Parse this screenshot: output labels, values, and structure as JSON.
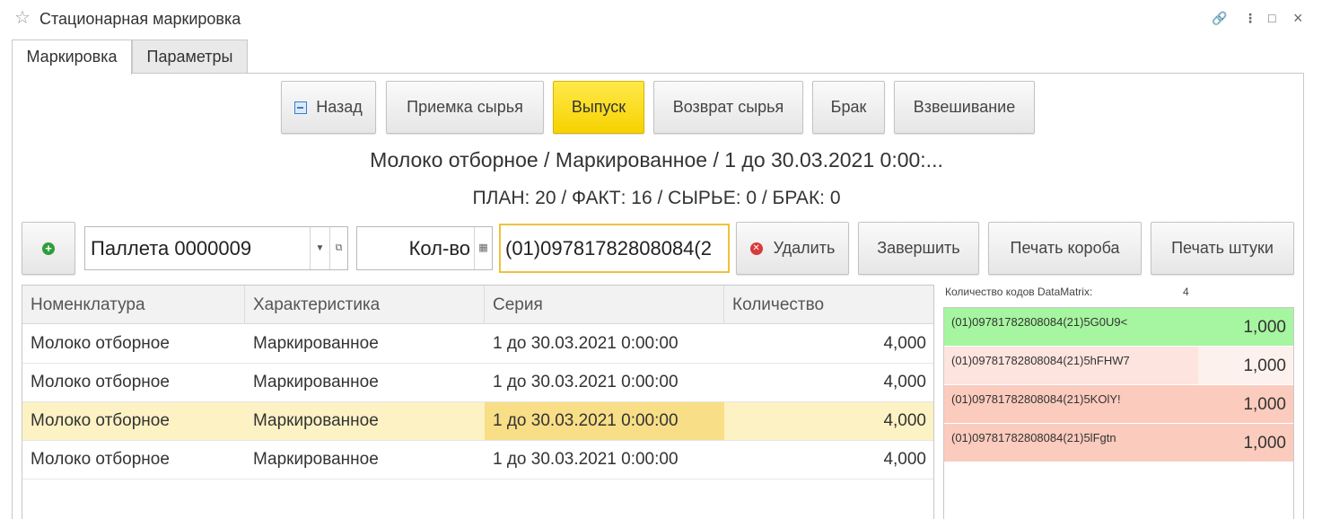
{
  "window": {
    "title": "Стационарная маркировка"
  },
  "tabs": [
    {
      "label": "Маркировка",
      "active": true
    },
    {
      "label": "Параметры",
      "active": false
    }
  ],
  "toolbar": {
    "back": "Назад",
    "receiving": "Приемка сырья",
    "release": "Выпуск",
    "return": "Возврат сырья",
    "defect": "Брак",
    "weighing": "Взвешивание"
  },
  "info": {
    "product_line": "Молоко отборное / Маркированное / 1 до 30.03.2021 0:00:...",
    "summary": "ПЛАН: 20 / ФАКТ: 16 / СЫРЬЕ: 0 / БРАК: 0"
  },
  "controls": {
    "pallet_value": "Паллета 0000009",
    "qty_placeholder": "Кол-во",
    "code_value": "(01)09781782808084(2",
    "delete": "Удалить",
    "finish": "Завершить",
    "print_box": "Печать короба",
    "print_item": "Печать штуки"
  },
  "grid": {
    "columns": [
      "Номенклатура",
      "Характеристика",
      "Серия",
      "Количество"
    ],
    "rows": [
      {
        "nomenclature": "Молоко отборное",
        "characteristic": "Маркированное",
        "series": "1 до 30.03.2021 0:00:00",
        "qty": "4,000",
        "selected": false
      },
      {
        "nomenclature": "Молоко отборное",
        "characteristic": "Маркированное",
        "series": "1 до 30.03.2021 0:00:00",
        "qty": "4,000",
        "selected": false
      },
      {
        "nomenclature": "Молоко отборное",
        "characteristic": "Маркированное",
        "series": "1 до 30.03.2021 0:00:00",
        "qty": "4,000",
        "selected": true
      },
      {
        "nomenclature": "Молоко отборное",
        "characteristic": "Маркированное",
        "series": "1 до 30.03.2021 0:00:00",
        "qty": "4,000",
        "selected": false
      }
    ]
  },
  "datamatrix": {
    "label": "Количество кодов DataMatrix:",
    "count": "4",
    "items": [
      {
        "code": "(01)09781782808084(21)5G0U9<",
        "qty": "1,000",
        "color": "#a6f5a0"
      },
      {
        "code": "(01)09781782808084(21)5hFHW7",
        "qty": "1,000",
        "color": "#fde4de"
      },
      {
        "code": "(01)09781782808084(21)5KOlY!",
        "qty": "1,000",
        "color": "#fbcbbd"
      },
      {
        "code": "(01)09781782808084(21)5lFgtn",
        "qty": "1,000",
        "color": "#fbcbbd"
      }
    ]
  },
  "colors": {
    "accent_yellow": "#f7d200",
    "selected_row": "#fdf2c4",
    "selected_cell": "#f8de86"
  }
}
